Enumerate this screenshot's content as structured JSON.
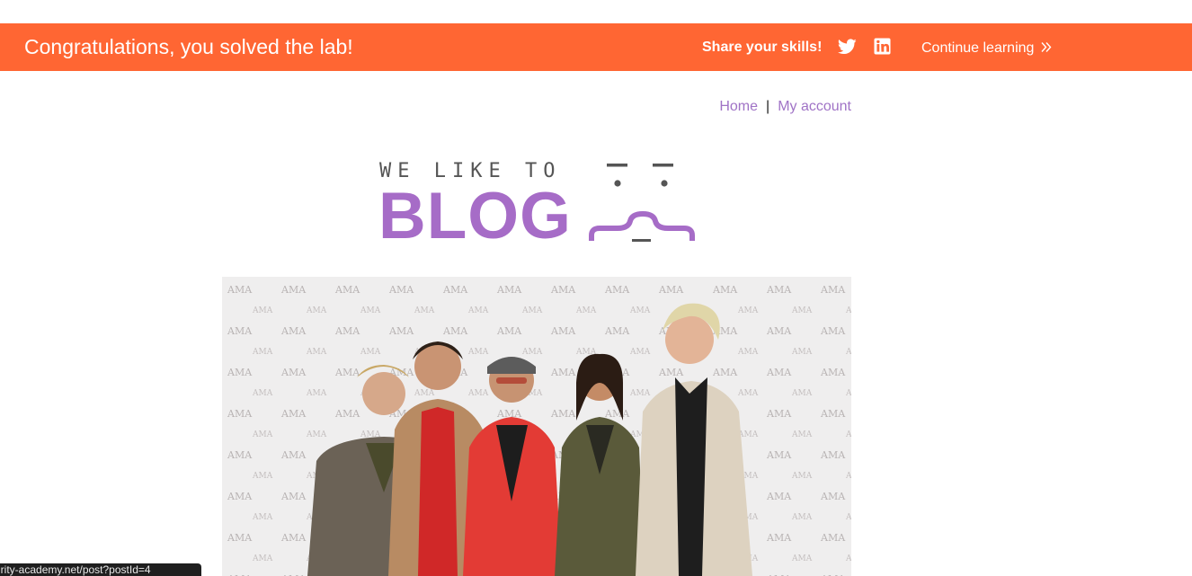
{
  "banner": {
    "title": "Congratulations, you solved the lab!",
    "share_label": "Share your skills!",
    "continue_label": "Continue learning",
    "background": "#ff6633",
    "icons": [
      "twitter-icon",
      "linkedin-icon",
      "chevron-double-right-icon"
    ]
  },
  "nav": {
    "home": "Home",
    "separator": "|",
    "account": "My account",
    "link_color": "#a073c6"
  },
  "logo": {
    "tagline": "WE LIKE TO",
    "word": "BLOG",
    "accent": "#a66cc7"
  },
  "status_bar": {
    "url": "urity-academy.net/post?postId=4"
  }
}
